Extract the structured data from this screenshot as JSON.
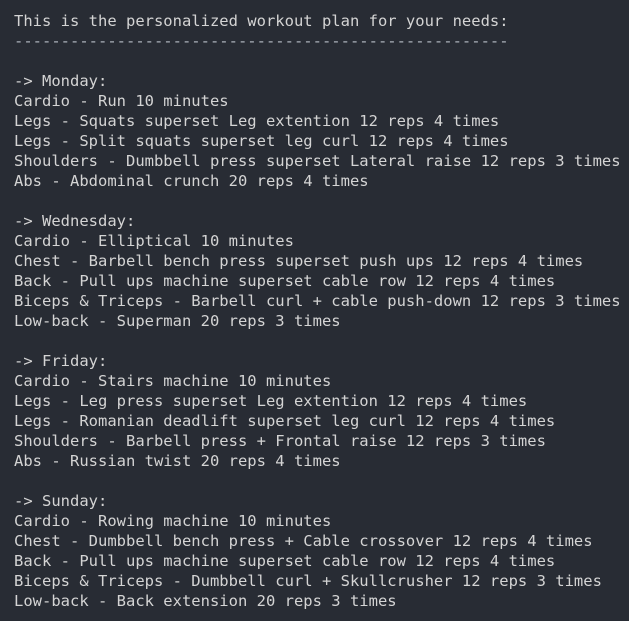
{
  "header": {
    "intro": "This is the personalized workout plan for your needs:",
    "separator": "-----------------------------------------------------"
  },
  "days": [
    {
      "heading": "-> Monday:",
      "exercises": [
        "Cardio - Run 10 minutes",
        "Legs - Squats superset Leg extention 12 reps 4 times",
        "Legs - Split squats superset leg curl 12 reps 4 times",
        "Shoulders - Dumbbell press superset Lateral raise 12 reps 3 times",
        "Abs - Abdominal crunch 20 reps 4 times"
      ]
    },
    {
      "heading": "-> Wednesday:",
      "exercises": [
        "Cardio - Elliptical 10 minutes",
        "Chest - Barbell bench press superset push ups 12 reps 4 times",
        "Back - Pull ups machine superset cable row 12 reps 4 times",
        "Biceps & Triceps - Barbell curl + cable push-down 12 reps 3 times",
        "Low-back - Superman 20 reps 3 times"
      ]
    },
    {
      "heading": "-> Friday:",
      "exercises": [
        "Cardio - Stairs machine 10 minutes",
        "Legs - Leg press superset Leg extention 12 reps 4 times",
        "Legs - Romanian deadlift superset leg curl 12 reps 4 times",
        "Shoulders - Barbell press + Frontal raise 12 reps 3 times",
        "Abs - Russian twist 20 reps 4 times"
      ]
    },
    {
      "heading": "-> Sunday:",
      "exercises": [
        "Cardio - Rowing machine 10 minutes",
        "Chest - Dumbbell bench press + Cable crossover 12 reps 4 times",
        "Back - Pull ups machine superset cable row 12 reps 4 times",
        "Biceps & Triceps - Dumbbell curl + Skullcrusher 12 reps 3 times",
        "Low-back - Back extension 20 reps 3 times"
      ]
    }
  ]
}
